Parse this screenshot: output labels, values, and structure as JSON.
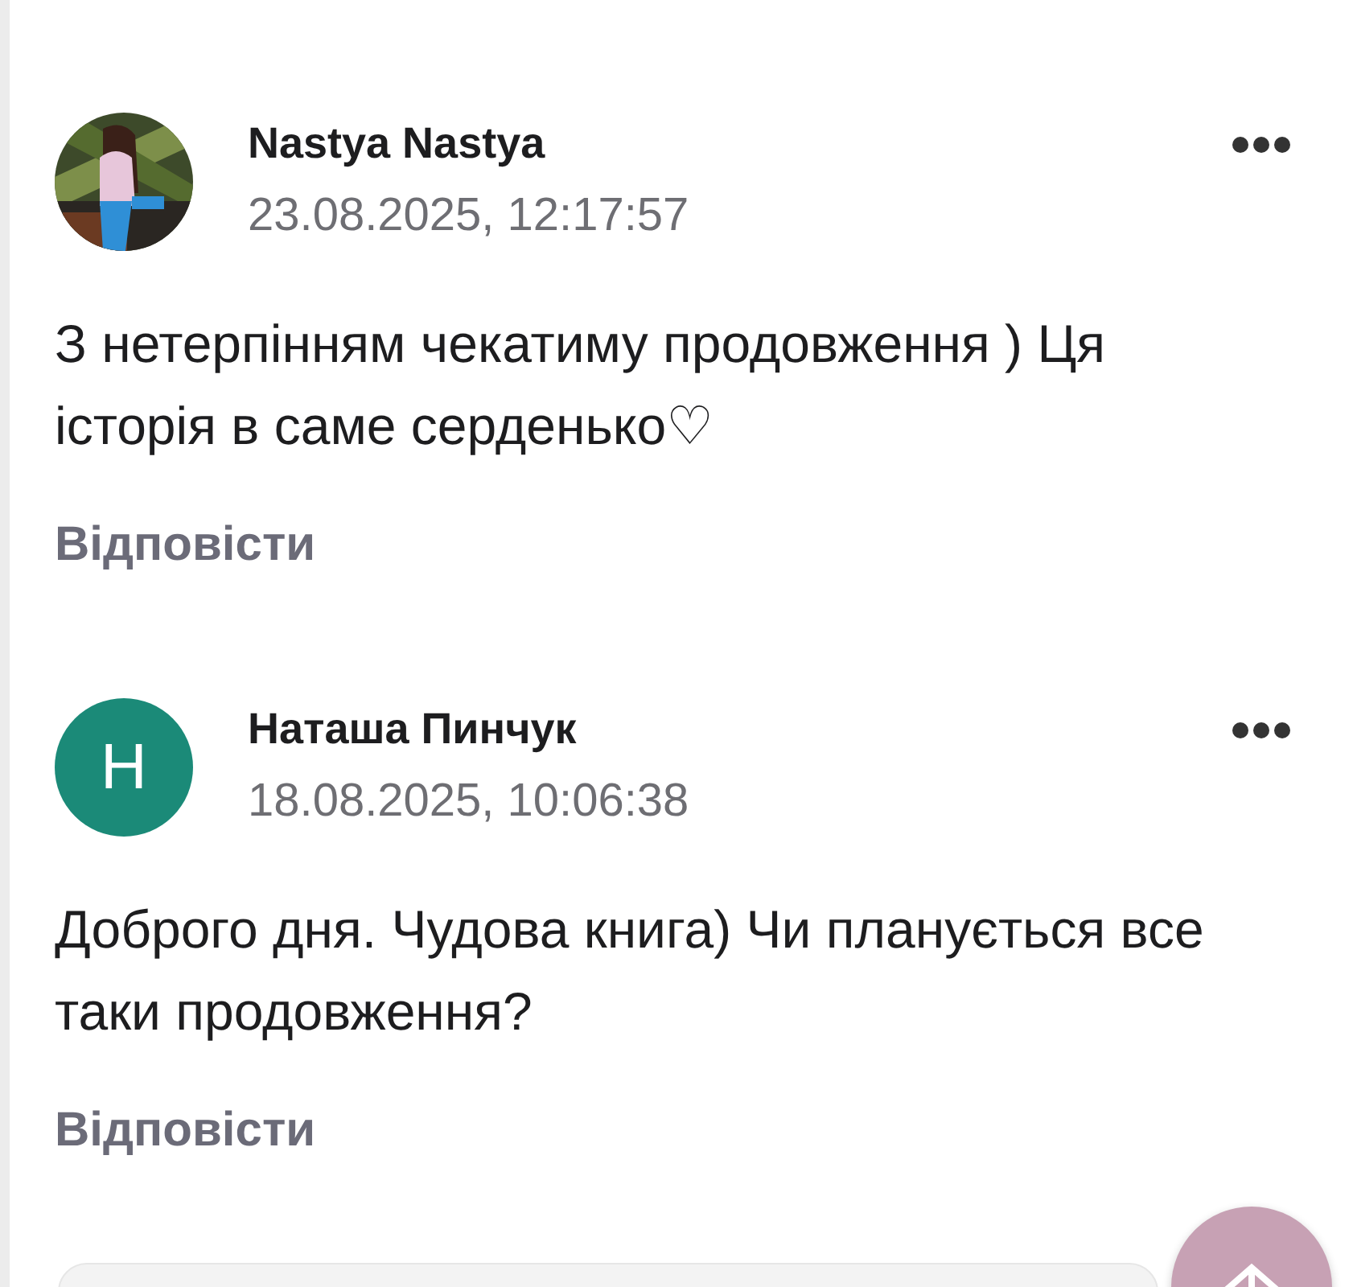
{
  "comments": [
    {
      "author": "Nastya Nastya",
      "date": "23.08.2025, 12:17:57",
      "text": "З нетерпінням чекатиму продовження ) Ця історія в саме серденько♡",
      "reply": "Відповісти"
    },
    {
      "author": "Наташа Пинчук",
      "date": "18.08.2025, 10:06:38",
      "avatar": {
        "kind": "letter",
        "initial": "Н",
        "color": "#1b8a78"
      },
      "text": "Доброго дня. Чудова книга) Чи планується все таки продовження?",
      "reply": "Відповісти"
    }
  ]
}
